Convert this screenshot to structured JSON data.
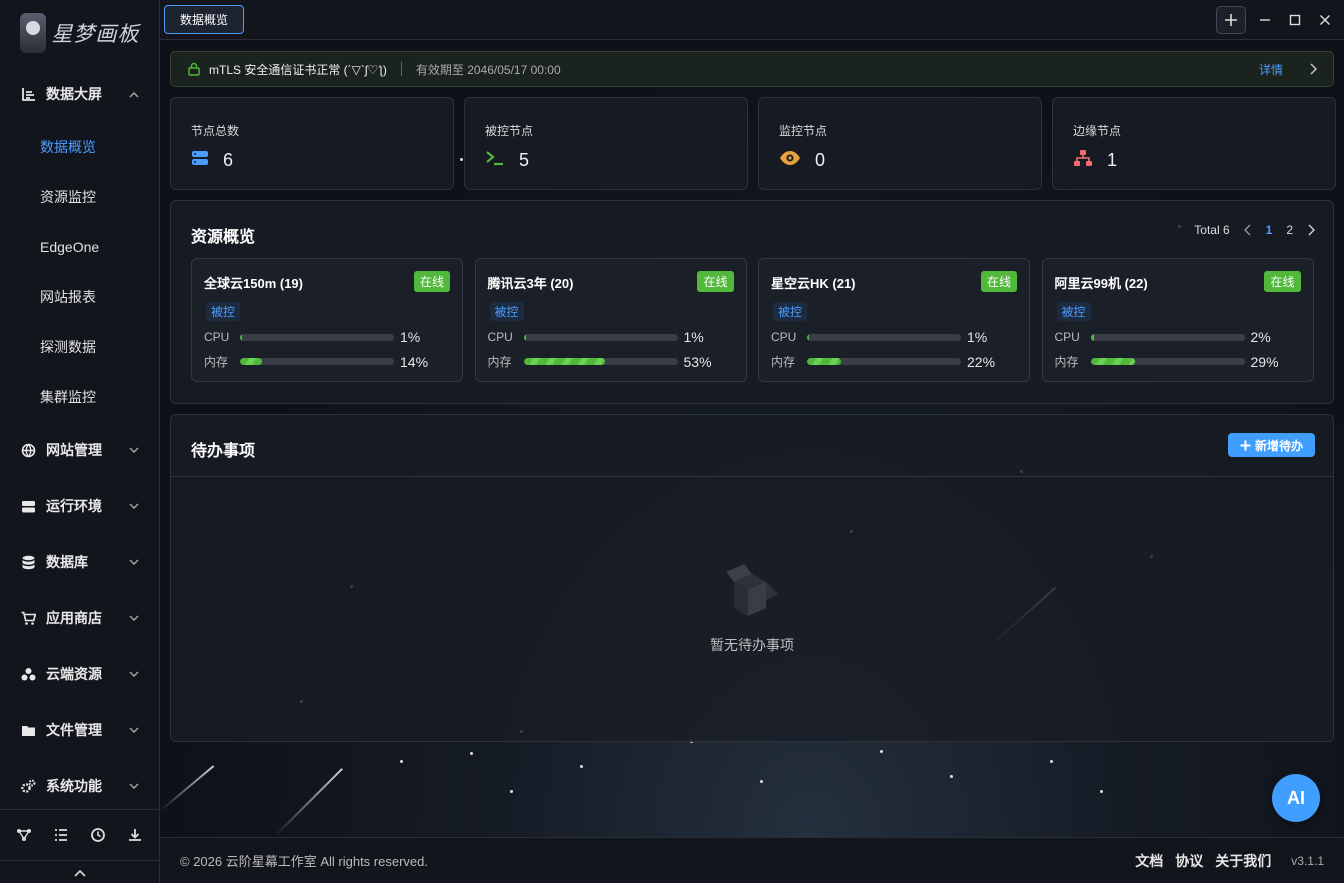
{
  "app": {
    "logo_text": "星梦画板"
  },
  "titlebar": {
    "tab_label": "数据概览"
  },
  "sidebar": {
    "groups": [
      {
        "label": "数据大屏",
        "icon": "chart-bar-icon",
        "expanded": true,
        "items": [
          "数据概览",
          "资源监控",
          "EdgeOne",
          "网站报表",
          "探测数据",
          "集群监控"
        ]
      },
      {
        "label": "网站管理",
        "icon": "globe-icon"
      },
      {
        "label": "运行环境",
        "icon": "server-icon"
      },
      {
        "label": "数据库",
        "icon": "database-icon"
      },
      {
        "label": "应用商店",
        "icon": "cart-icon"
      },
      {
        "label": "云端资源",
        "icon": "cloud-nodes-icon"
      },
      {
        "label": "文件管理",
        "icon": "folder-icon"
      },
      {
        "label": "系统功能",
        "icon": "gears-icon"
      }
    ],
    "active_item": "数据概览"
  },
  "cert": {
    "title": "mTLS 安全通信证书正常 (´▽`ʃ♡ƪ)",
    "expiry": "有效期至 2046/05/17 00:00",
    "detail": "详情"
  },
  "stats": [
    {
      "label": "节点总数",
      "value": "6",
      "icon": "server-stack-icon",
      "color": "#4d9cff"
    },
    {
      "label": "被控节点",
      "value": "5",
      "icon": "terminal-icon",
      "color": "#52b83b"
    },
    {
      "label": "监控节点",
      "value": "0",
      "icon": "eye-icon",
      "color": "#e6a23c"
    },
    {
      "label": "边缘节点",
      "value": "1",
      "icon": "network-icon",
      "color": "#f56c6c"
    }
  ],
  "resources": {
    "title": "资源概览",
    "total": "Total 6",
    "pages": [
      "1",
      "2"
    ],
    "current_page": "1",
    "nodes": [
      {
        "name": "全球云150m (19)",
        "status": "在线",
        "tag": "被控",
        "cpu_label": "CPU",
        "cpu": "1%",
        "cpu_value": 1,
        "mem_label": "内存",
        "mem": "14%",
        "mem_value": 14
      },
      {
        "name": "腾讯云3年 (20)",
        "status": "在线",
        "tag": "被控",
        "cpu_label": "CPU",
        "cpu": "1%",
        "cpu_value": 1,
        "mem_label": "内存",
        "mem": "53%",
        "mem_value": 53
      },
      {
        "name": "星空云HK (21)",
        "status": "在线",
        "tag": "被控",
        "cpu_label": "CPU",
        "cpu": "1%",
        "cpu_value": 1,
        "mem_label": "内存",
        "mem": "22%",
        "mem_value": 22
      },
      {
        "name": "阿里云99机 (22)",
        "status": "在线",
        "tag": "被控",
        "cpu_label": "CPU",
        "cpu": "2%",
        "cpu_value": 2,
        "mem_label": "内存",
        "mem": "29%",
        "mem_value": 29
      }
    ]
  },
  "todo": {
    "title": "待办事项",
    "add_label": "新增待办",
    "empty_text": "暂无待办事项"
  },
  "ai_button": "AI",
  "footer": {
    "copyright": "© 2026 云阶星幕工作室 All rights reserved.",
    "links": [
      "文档",
      "协议",
      "关于我们"
    ],
    "version": "v3.1.1"
  }
}
